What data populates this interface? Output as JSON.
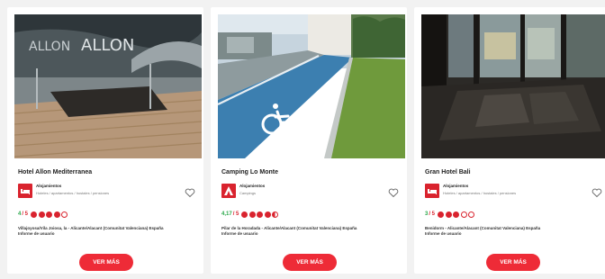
{
  "cards": [
    {
      "title": "Hotel Allon Mediterranea",
      "category": "Alojamientos",
      "category_types": "Hoteles / apartamentos / hostales / pensiones",
      "category_icon": "bed-icon",
      "rating_value": "4",
      "rating_max": "/ 5",
      "rating_level": 4,
      "location": "Villajoyosa/Vila Joiosa, la - Alicante/Alacant (Comunitat Valenciana) España",
      "report": "Informe de usuario",
      "button": "VER MÁS"
    },
    {
      "title": "Camping Lo Monte",
      "category": "Alojamientos",
      "category_types": "Campings",
      "category_icon": "tent-icon",
      "rating_value": "4,17",
      "rating_max": "/ 5",
      "rating_level": 4.17,
      "location": "Pilar de la Horadada - Alicante/Alacant (Comunitat Valenciana) España",
      "report": "Informe de usuario",
      "button": "VER MÁS"
    },
    {
      "title": "Gran Hotel Bali",
      "category": "Alojamientos",
      "category_types": "Hoteles / apartamentos / hostales / pensiones",
      "category_icon": "bed-icon",
      "rating_value": "3",
      "rating_max": "/ 5",
      "rating_level": 3,
      "location": "Benidorm - Alicante/Alacant (Comunitat Valenciana) España",
      "report": "Informe de usuario",
      "button": "VER MÁS"
    }
  ],
  "photo_signs": {
    "line1": "ALLON",
    "line2": "ALLON"
  },
  "colors": {
    "accent": "#ee2b37",
    "rating_green": "#2aa84a",
    "rating_red": "#d9232e"
  }
}
